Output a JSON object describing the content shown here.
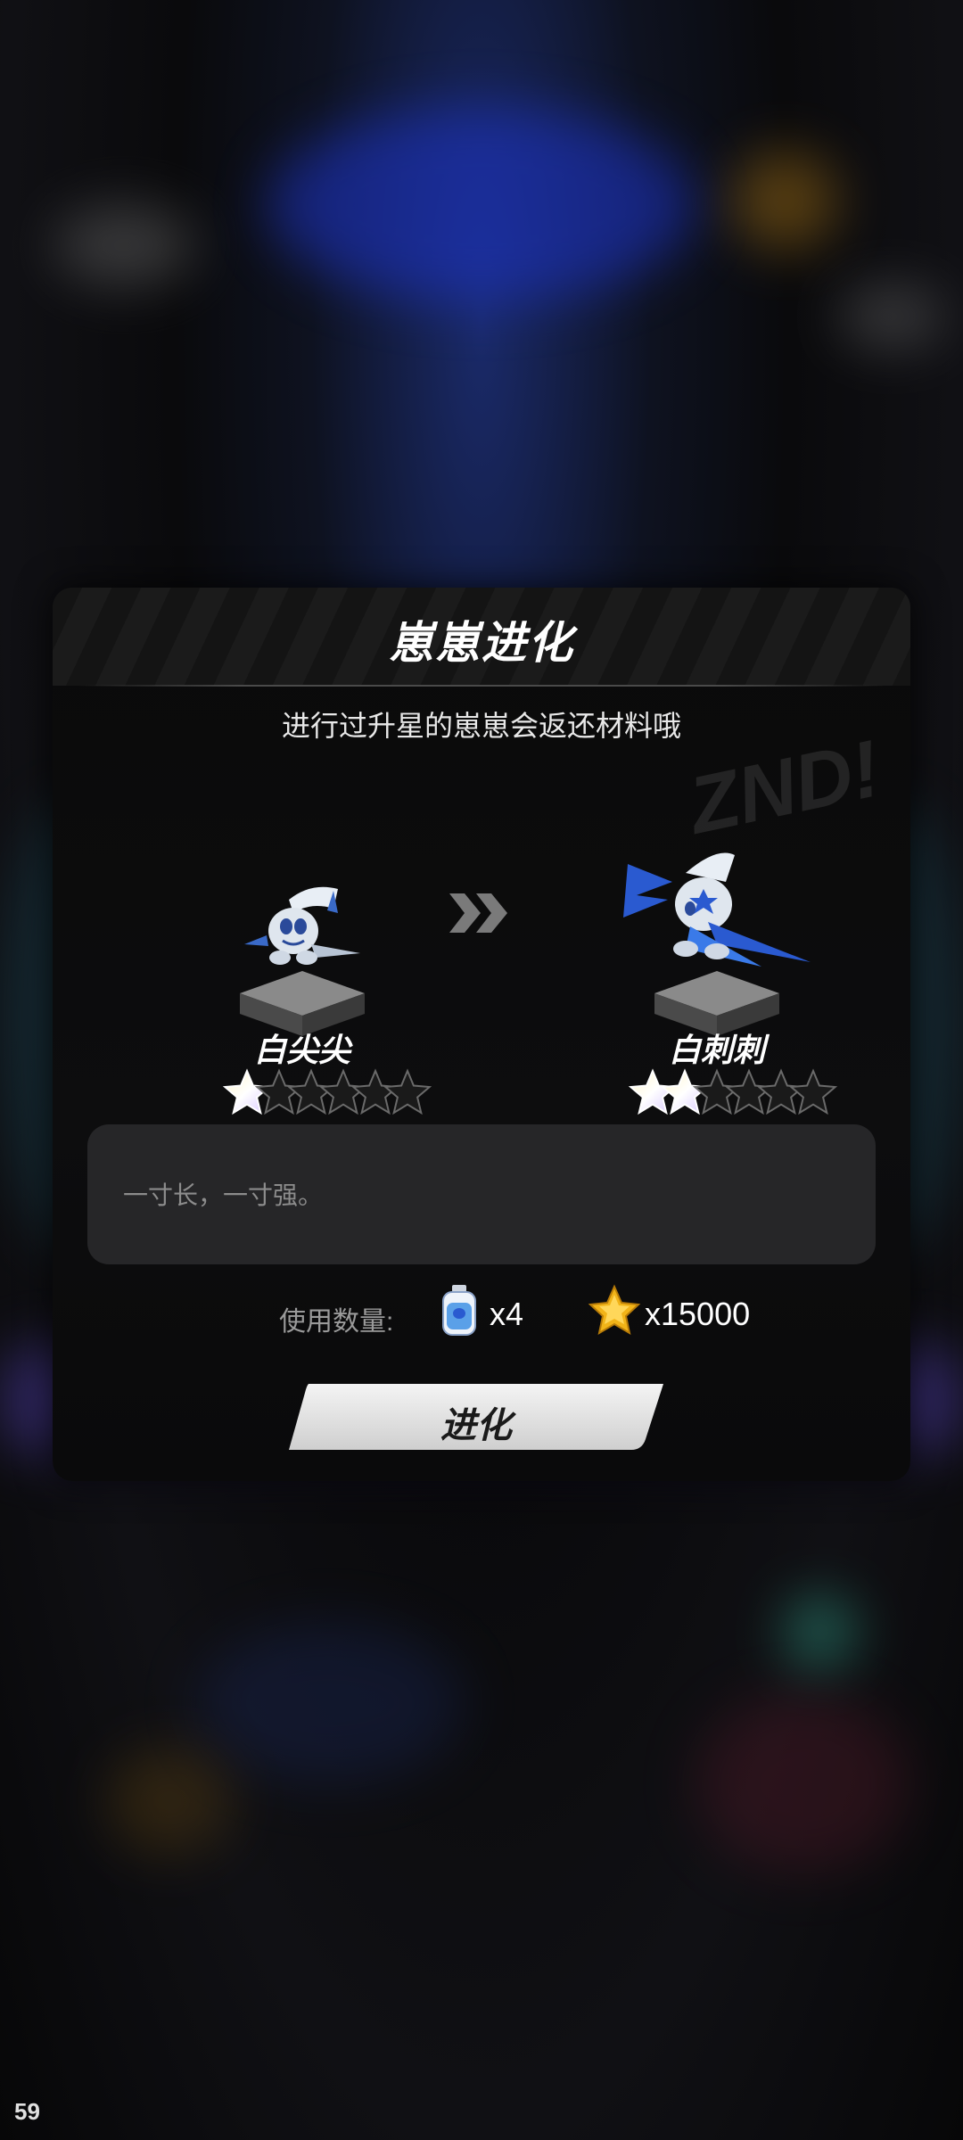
{
  "dialog": {
    "title": "崽崽进化",
    "subtitle": "进行过升星的崽崽会返还材料哦",
    "graffiti_text": "ZND!",
    "from_creature": {
      "name": "白尖尖",
      "stars_filled": 1,
      "stars_total": 6
    },
    "to_creature": {
      "name": "白刺刺",
      "stars_filled": 2,
      "stars_total": 6
    },
    "description": "一寸长，一寸强。",
    "cost": {
      "label": "使用数量:",
      "potion_qty": "x4",
      "coin_qty": "x15000"
    },
    "evolve_button": "进化"
  },
  "overlay": {
    "fps": "59"
  },
  "icons": {
    "arrow": "double-chevron-right-icon",
    "potion": "potion-bottle-icon",
    "coin": "gold-star-coin-icon",
    "star": "star-icon"
  },
  "colors": {
    "panel_bg": "#0a0a0a",
    "desc_bg": "#262628",
    "button_bg": "#e6e6e6",
    "coin": "#f2b418",
    "potion": "#5aa0e8"
  }
}
